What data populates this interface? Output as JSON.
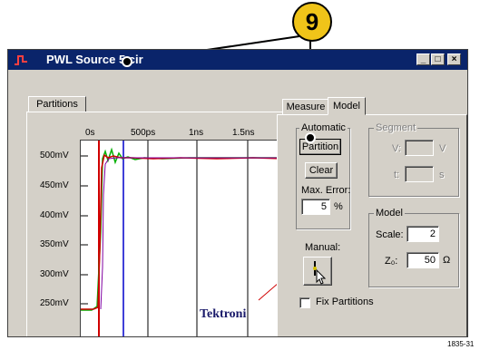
{
  "callout": {
    "number": "9"
  },
  "window": {
    "title": "PWL Source 5.cir",
    "controls": {
      "minimize": "_",
      "maximize": "□",
      "close": "×"
    }
  },
  "left_panel": {
    "tab": "Partitions",
    "x_ticks": [
      "0s",
      "500ps",
      "1ns",
      "1.5ns"
    ],
    "y_ticks": [
      "500mV",
      "450mV",
      "400mV",
      "350mV",
      "300mV",
      "250mV"
    ],
    "watermark": "Tektroni"
  },
  "right_panel": {
    "tabs": [
      "Measure",
      "Model"
    ],
    "automatic": {
      "label": "Automatic",
      "partition_button": "Partition",
      "clear_button": "Clear",
      "max_error_label": "Max. Error:",
      "max_error_value": "5",
      "max_error_unit": "%"
    },
    "segment": {
      "label": "Segment",
      "v_label": "V:",
      "v_unit": "V",
      "t_label": "t:",
      "t_unit": "s"
    },
    "model": {
      "label": "Model",
      "scale_label": "Scale:",
      "scale_value": "2",
      "z_label": "Z₀:",
      "z_value": "50",
      "z_unit": "Ω"
    },
    "manual": {
      "label": "Manual:"
    },
    "fix_partitions": {
      "label": "Fix Partitions",
      "checked": false
    }
  },
  "figure_id": "1835-31",
  "colors": {
    "titlebar": "#0a246a",
    "callout": "#f0c419",
    "trace_red": "#d00000",
    "trace_green": "#00b000",
    "cursor_blue": "#0000cc"
  }
}
